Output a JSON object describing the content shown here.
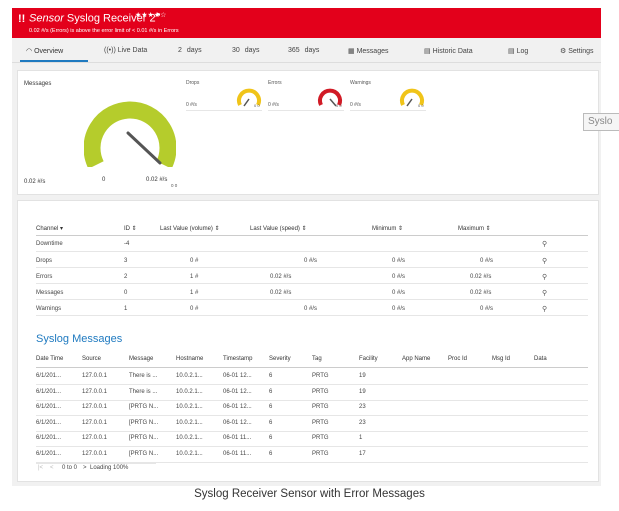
{
  "header": {
    "alert_icon": "!!",
    "title_italic": "Sensor",
    "title": "Syslog Receiver 2",
    "flag": "⚑",
    "stars": "★★★★☆",
    "status_text": "0.02 #/s (Errors) is above the error limit of < 0.01 #/s in Errors",
    "color": "#e3001b"
  },
  "tabs": [
    {
      "label": "Overview",
      "icon": "gauge-icon",
      "active": true
    },
    {
      "label": "Live Data",
      "icon": "live-data-icon"
    },
    {
      "label": "2  days"
    },
    {
      "label": "30  days"
    },
    {
      "label": "365  days"
    },
    {
      "label": "Messages",
      "icon": "messages-icon"
    },
    {
      "label": "Historic Data",
      "icon": "chart-icon"
    },
    {
      "label": "Log",
      "icon": "log-icon"
    },
    {
      "label": "Settings",
      "icon": "gear-icon"
    }
  ],
  "gauges": {
    "main": {
      "label": "Messages",
      "value": "0.02 #/s",
      "min_label": "0",
      "max_label": "0.02 #/s",
      "small": "0  0",
      "color": "#b5cc2c"
    },
    "small": [
      {
        "label": "Drops",
        "value": "0 #/s",
        "small": "0  0",
        "color": "#f0c419"
      },
      {
        "label": "Errors",
        "value": "0 #/s",
        "small": "0  0",
        "color": "#d11b26"
      },
      {
        "label": "Warnings",
        "value": "0 #/s",
        "small": "0  0",
        "color": "#f0c419"
      }
    ]
  },
  "channels": {
    "headers": [
      "Channel ▾",
      "ID ⇕",
      "Last Value (volume) ⇕",
      "Last Value (speed) ⇕",
      "Minimum ⇕",
      "Maximum ⇕"
    ],
    "rows": [
      {
        "channel": "Downtime",
        "id": "-4",
        "volume": "",
        "speed": "",
        "min": "",
        "max": ""
      },
      {
        "channel": "Drops",
        "id": "3",
        "volume": "0 #",
        "speed": "0 #/s",
        "min": "0 #/s",
        "max": "0 #/s"
      },
      {
        "channel": "Errors",
        "id": "2",
        "volume": "1 #",
        "speed": "0.02 #/s",
        "min": "0 #/s",
        "max": "0.02 #/s"
      },
      {
        "channel": "Messages",
        "id": "0",
        "volume": "1 #",
        "speed": "0.02 #/s",
        "min": "0 #/s",
        "max": "0.02 #/s"
      },
      {
        "channel": "Warnings",
        "id": "1",
        "volume": "0 #",
        "speed": "0 #/s",
        "min": "0 #/s",
        "max": "0 #/s"
      }
    ]
  },
  "syslog": {
    "title": "Syslog Messages",
    "headers": [
      "Date Time",
      "Source",
      "Message",
      "Hostname",
      "Timestamp",
      "Severity",
      "Tag",
      "Facility",
      "App Name",
      "Proc Id",
      "Msg Id",
      "Data"
    ],
    "rows": [
      [
        "6/1/201...",
        "127.0.0.1",
        "There is ...",
        "10.0.2.1...",
        "06-01 12...",
        "6",
        "PRTG",
        "19"
      ],
      [
        "6/1/201...",
        "127.0.0.1",
        "There is ...",
        "10.0.2.1...",
        "06-01 12...",
        "6",
        "PRTG",
        "19"
      ],
      [
        "6/1/201...",
        "127.0.0.1",
        "[PRTG N...",
        "10.0.2.1...",
        "06-01 12...",
        "6",
        "PRTG",
        "23"
      ],
      [
        "6/1/201...",
        "127.0.0.1",
        "[PRTG N...",
        "10.0.2.1...",
        "06-01 12...",
        "6",
        "PRTG",
        "23"
      ],
      [
        "6/1/201...",
        "127.0.0.1",
        "[PRTG N...",
        "10.0.2.1...",
        "06-01 11...",
        "6",
        "PRTG",
        "1"
      ],
      [
        "6/1/201...",
        "127.0.0.1",
        "[PRTG N...",
        "10.0.2.1...",
        "06-01 11...",
        "6",
        "PRTG",
        "17"
      ]
    ],
    "pager": "0 to 0",
    "loading": "Loading 100%"
  },
  "popup_text": "Syslo",
  "caption": "Syslog Receiver Sensor with Error Messages"
}
